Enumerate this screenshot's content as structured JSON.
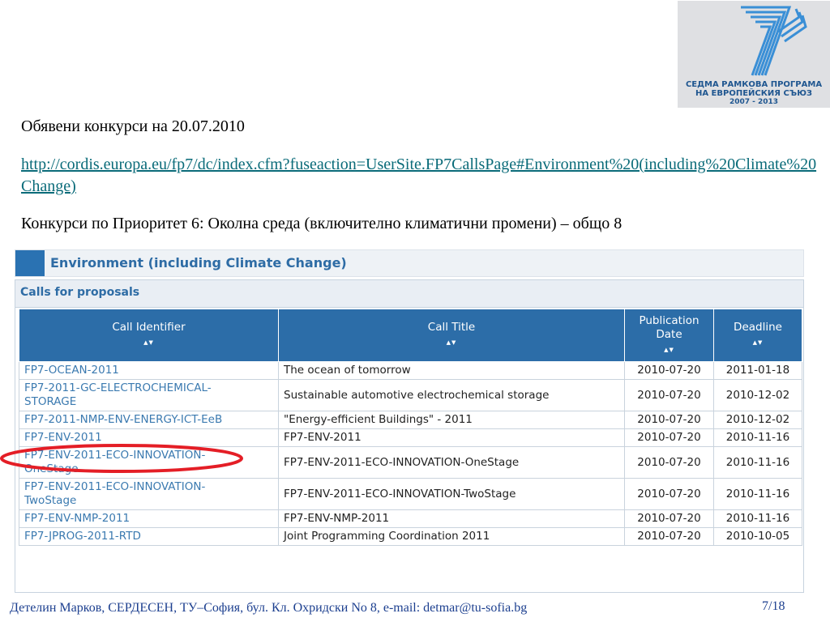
{
  "logo": {
    "line1": "СЕДМА РАМКОВА ПРОГРАМА",
    "line2": "НА ЕВРОПЕЙСКИЯ СЪЮЗ",
    "line3": "2007 - 2013"
  },
  "heading": "Обявени конкурси на 20.07.2010",
  "link": "http://cordis.europa.eu/fp7/dc/index.cfm?fuseaction=UserSite.FP7CallsPage#Environment%20(including%20Climate%20Change)",
  "subtitle": "Конкурси  по Приоритет 6: Околна среда (включително климатични промени) – общо 8",
  "panel": {
    "title": "Environment (including Climate Change)",
    "calls_title": "Calls for proposals"
  },
  "table": {
    "headers": [
      "Call Identifier",
      "Call Title",
      "Publication Date",
      "Deadline"
    ],
    "sort_glyph": "▲▼",
    "rows": [
      {
        "id": "FP7-OCEAN-2011",
        "title": "The ocean of tomorrow",
        "pub": "2010-07-20",
        "deadline": "2011-01-18"
      },
      {
        "id": "FP7-2011-GC-ELECTROCHEMICAL-STORAGE",
        "title": "Sustainable automotive electrochemical storage",
        "pub": "2010-07-20",
        "deadline": "2010-12-02"
      },
      {
        "id": "FP7-2011-NMP-ENV-ENERGY-ICT-EeB",
        "title": "\"Energy-efficient Buildings\" - 2011",
        "pub": "2010-07-20",
        "deadline": "2010-12-02"
      },
      {
        "id": "FP7-ENV-2011",
        "title": "FP7-ENV-2011",
        "pub": "2010-07-20",
        "deadline": "2010-11-16"
      },
      {
        "id": "FP7-ENV-2011-ECO-INNOVATION-OneStage",
        "title": "FP7-ENV-2011-ECO-INNOVATION-OneStage",
        "pub": "2010-07-20",
        "deadline": "2010-11-16"
      },
      {
        "id": "FP7-ENV-2011-ECO-INNOVATION-TwoStage",
        "title": "FP7-ENV-2011-ECO-INNOVATION-TwoStage",
        "pub": "2010-07-20",
        "deadline": "2010-11-16"
      },
      {
        "id": "FP7-ENV-NMP-2011",
        "title": "FP7-ENV-NMP-2011",
        "pub": "2010-07-20",
        "deadline": "2010-11-16"
      },
      {
        "id": "FP7-JPROG-2011-RTD",
        "title": "Joint Programming Coordination 2011",
        "pub": "2010-07-20",
        "deadline": "2010-10-05"
      }
    ]
  },
  "footer": "Детелин Марков, СЕРДЕСЕН, ТУ–София, бул. Кл. Охридски No 8, e-mail: detmar@tu-sofia.bg",
  "page_number": "7/18",
  "colors": {
    "header_blue": "#2c6da8",
    "link_teal": "#0a6b79",
    "highlight_red": "#e41e26",
    "footer_blue": "#1c3f8f"
  }
}
